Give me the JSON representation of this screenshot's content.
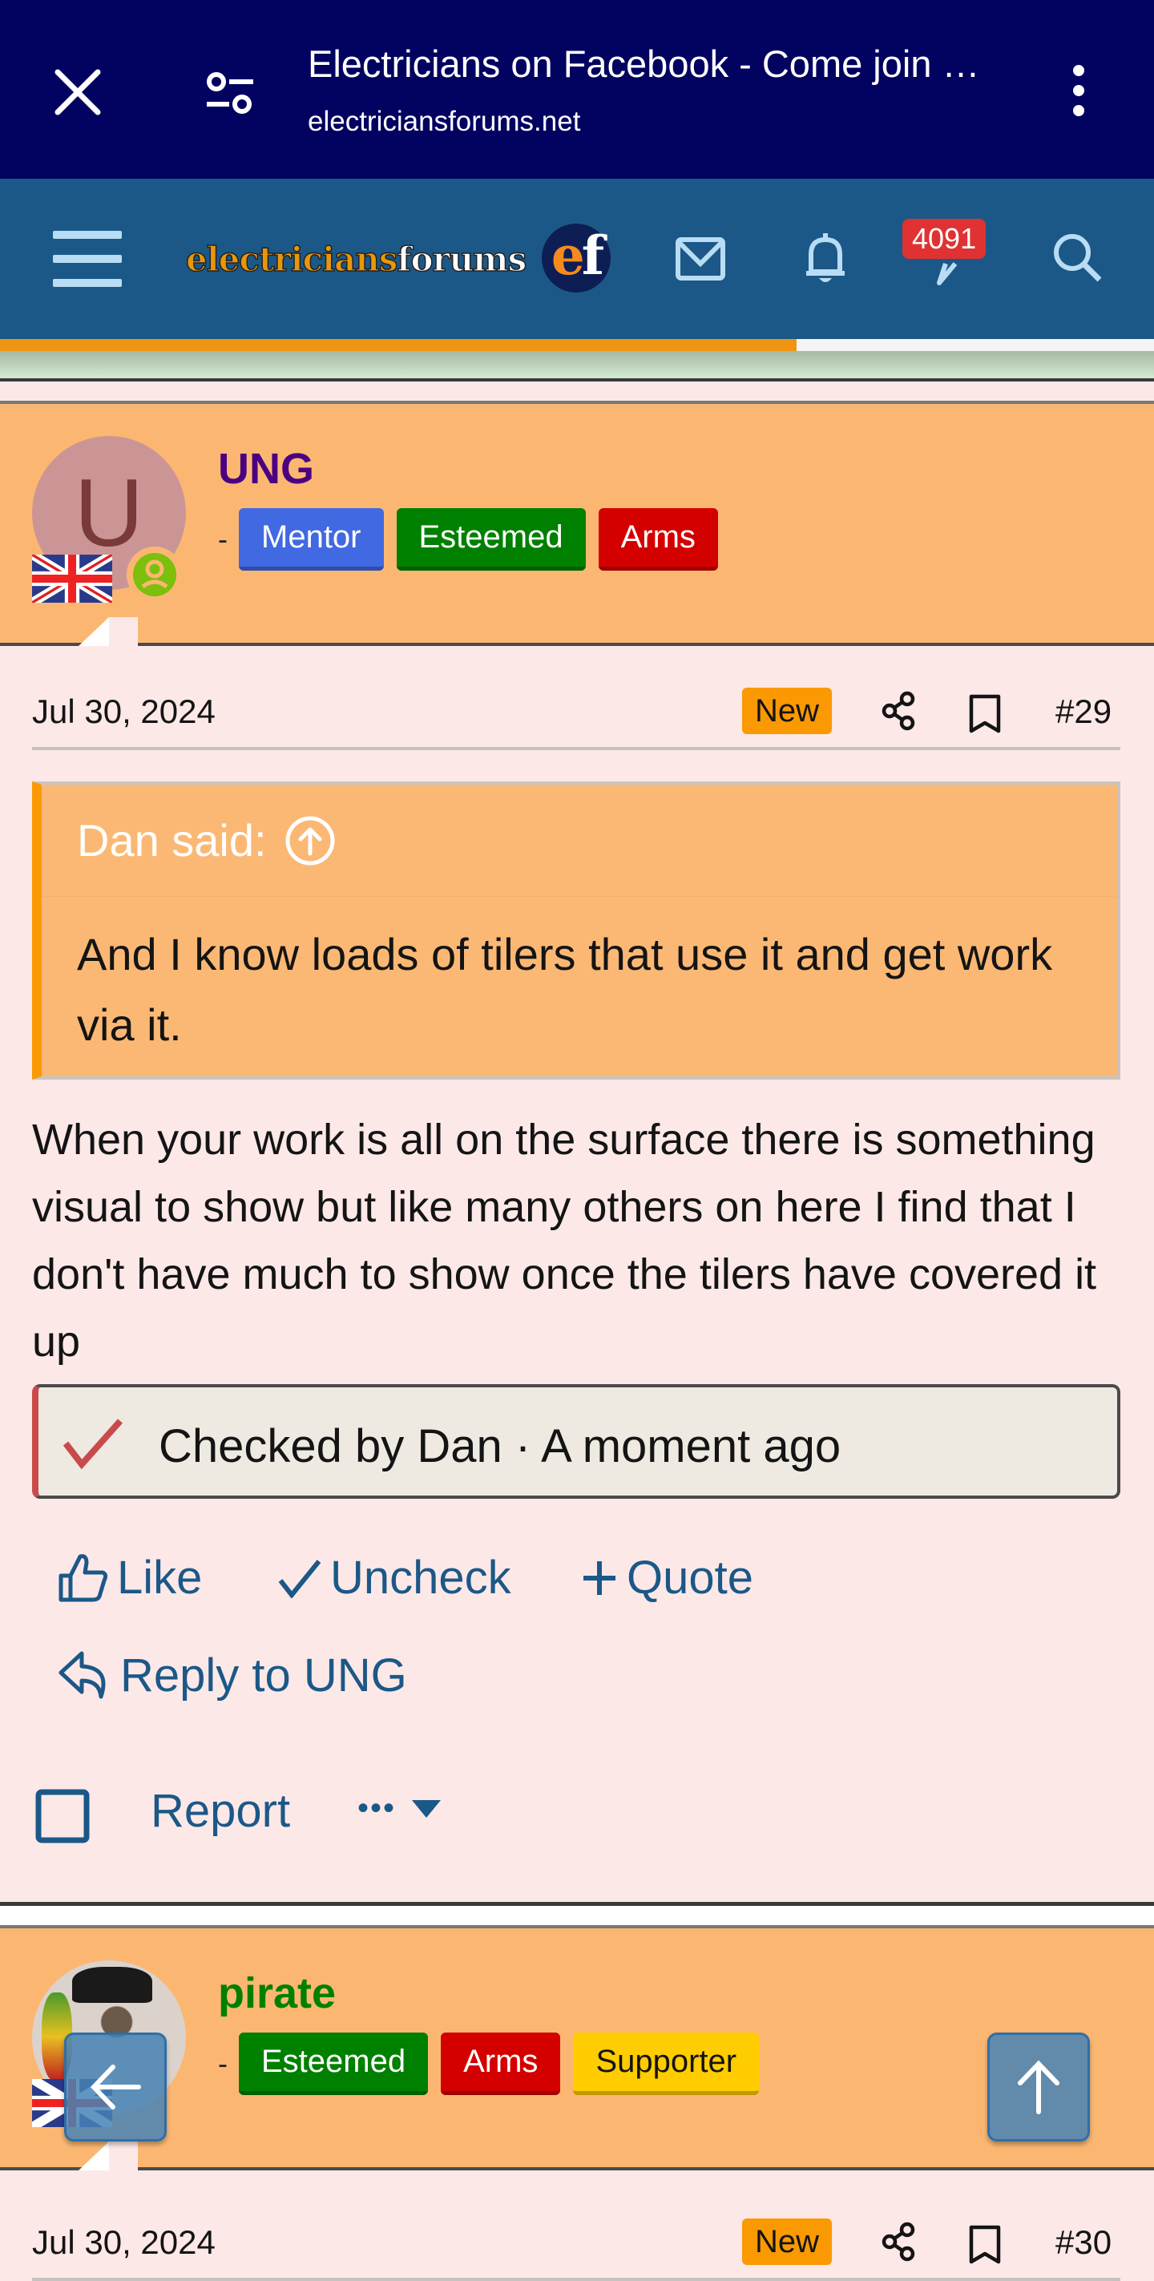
{
  "browser": {
    "title": "Electricians on Facebook - Come join …",
    "url": "electriciansforums.net"
  },
  "nav": {
    "logo_part1": "electricians",
    "logo_part2": "forums",
    "logo_badge_e": "e",
    "logo_badge_f": "f",
    "conversations_badge": "4091",
    "page_progress_percent": 69
  },
  "posts": [
    {
      "avatar_letter": "U",
      "username": "UNG",
      "username_color": "#4b0082",
      "banner_dash": "-",
      "banners": [
        {
          "label": "Mentor",
          "bg": "#4169e1",
          "color": "#ffffff"
        },
        {
          "label": "Esteemed",
          "bg": "#008000",
          "color": "#ffffff"
        },
        {
          "label": "Arms",
          "bg": "#d40000",
          "color": "#ffffff"
        }
      ],
      "date": "Jul 30, 2024",
      "new_label": "New",
      "post_number": "#29",
      "quote": {
        "author_line": "Dan said:",
        "text": "And I know loads of tilers that use it and get work via it."
      },
      "body": "When your work is all on the surface there is something visual to show but like many others on here I find that I don't have much to show once the tilers have covered it up",
      "checked_text": "Checked by Dan · A moment ago",
      "actions": {
        "like": "Like",
        "uncheck": "Uncheck",
        "quote": "Quote",
        "reply": "Reply to UNG",
        "report": "Report",
        "more": "•••"
      }
    },
    {
      "username": "pirate",
      "username_color": "#008000",
      "banner_dash": "-",
      "banners": [
        {
          "label": "Esteemed",
          "bg": "#008000",
          "color": "#ffffff"
        },
        {
          "label": "Arms",
          "bg": "#d40000",
          "color": "#ffffff"
        },
        {
          "label": "Supporter",
          "bg": "#ffcc00",
          "color": "#141414"
        }
      ],
      "date": "Jul 30, 2024",
      "new_label": "New",
      "post_number": "#30"
    }
  ]
}
